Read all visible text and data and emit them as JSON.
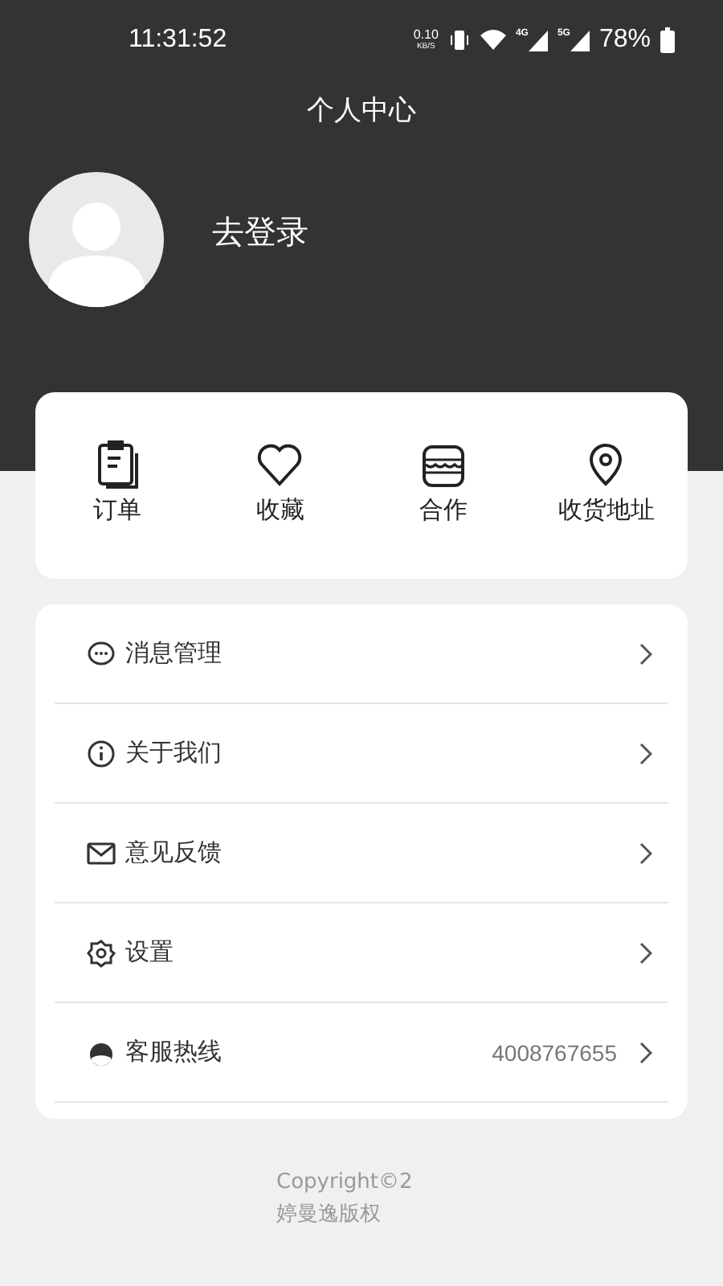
{
  "status_bar": {
    "time": "11:31:52",
    "net_speed": "0.10",
    "net_unit": "KB/S",
    "net_4g": "4G",
    "net_5g": "5G",
    "battery": "78%"
  },
  "header": {
    "title": "个人中心"
  },
  "profile": {
    "login": "去登录"
  },
  "shortcuts": [
    {
      "kind": "order",
      "label": "订单"
    },
    {
      "kind": "favorite",
      "label": "收藏"
    },
    {
      "kind": "shop",
      "label": "合作"
    },
    {
      "kind": "address",
      "label": "收货地址"
    }
  ],
  "menu": [
    {
      "kind": "message",
      "label": "消息管理"
    },
    {
      "kind": "about",
      "label": "关于我们"
    },
    {
      "kind": "feedback",
      "label": "意见反馈"
    },
    {
      "kind": "settings",
      "label": "设置"
    },
    {
      "kind": "service",
      "label": "客服热线",
      "value": "4008767655"
    }
  ],
  "footer": {
    "copyright": "Copyright©2",
    "owner": "婷曼逸版权"
  }
}
